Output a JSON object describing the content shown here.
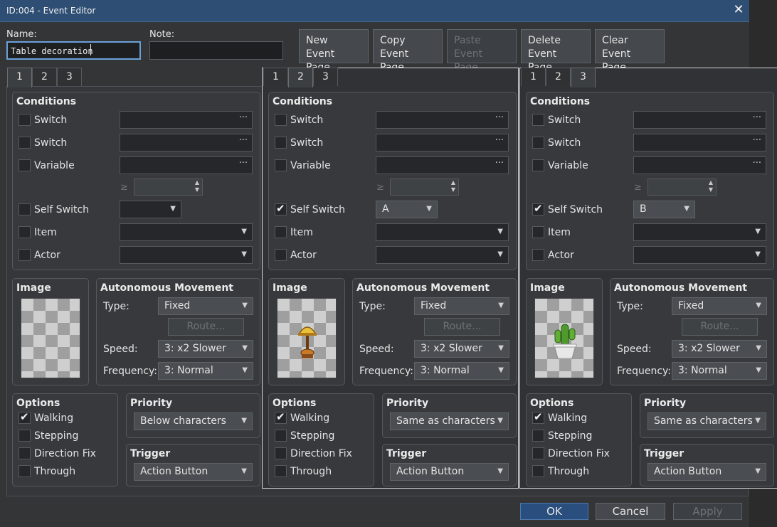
{
  "window": {
    "title": "ID:004 - Event Editor",
    "close_glyph": "✕"
  },
  "header": {
    "name_label": "Name:",
    "name_value": "Table decoration",
    "note_label": "Note:",
    "note_value": "",
    "buttons": [
      {
        "line1": "New",
        "line2": "Event Page",
        "enabled": true
      },
      {
        "line1": "Copy",
        "line2": "Event Page",
        "enabled": true
      },
      {
        "line1": "Paste",
        "line2": "Event Page",
        "enabled": false
      },
      {
        "line1": "Delete",
        "line2": "Event Page",
        "enabled": true
      },
      {
        "line1": "Clear",
        "line2": "Event Page",
        "enabled": true
      }
    ]
  },
  "labels": {
    "conditions": "Conditions",
    "switch": "Switch",
    "variable": "Variable",
    "ge": "≥",
    "self_switch": "Self Switch",
    "item": "Item",
    "actor": "Actor",
    "image": "Image",
    "autonomous_movement": "Autonomous Movement",
    "type": "Type:",
    "route": "Route...",
    "speed": "Speed:",
    "frequency": "Frequency:",
    "options": "Options",
    "walking": "Walking",
    "stepping": "Stepping",
    "direction_fix": "Direction Fix",
    "through": "Through",
    "priority": "Priority",
    "trigger": "Trigger",
    "dots": "···",
    "arrow": "▼"
  },
  "pages": [
    {
      "tabs": [
        "1",
        "2",
        "3"
      ],
      "active_tab": "1",
      "self_switch_checked": false,
      "self_switch_value": "",
      "image": "empty",
      "movement": {
        "type": "Fixed",
        "speed": "3: x2 Slower",
        "frequency": "3: Normal"
      },
      "options": {
        "walking": true,
        "stepping": false,
        "direction_fix": false,
        "through": false
      },
      "priority": "Below characters",
      "trigger": "Action Button"
    },
    {
      "tabs": [
        "1",
        "2",
        "3"
      ],
      "active_tab": "2",
      "self_switch_checked": true,
      "self_switch_value": "A",
      "image": "lamp",
      "movement": {
        "type": "Fixed",
        "speed": "3: x2 Slower",
        "frequency": "3: Normal"
      },
      "options": {
        "walking": true,
        "stepping": false,
        "direction_fix": false,
        "through": false
      },
      "priority": "Same as characters",
      "trigger": "Action Button"
    },
    {
      "tabs": [
        "1",
        "2",
        "3"
      ],
      "active_tab": "3",
      "self_switch_checked": true,
      "self_switch_value": "B",
      "image": "cactus",
      "movement": {
        "type": "Fixed",
        "speed": "3: x2 Slower",
        "frequency": "3: Normal"
      },
      "options": {
        "walking": true,
        "stepping": false,
        "direction_fix": false,
        "through": false
      },
      "priority": "Same as characters",
      "trigger": "Action Button"
    }
  ],
  "footer": {
    "ok": "OK",
    "cancel": "Cancel",
    "apply": "Apply"
  }
}
